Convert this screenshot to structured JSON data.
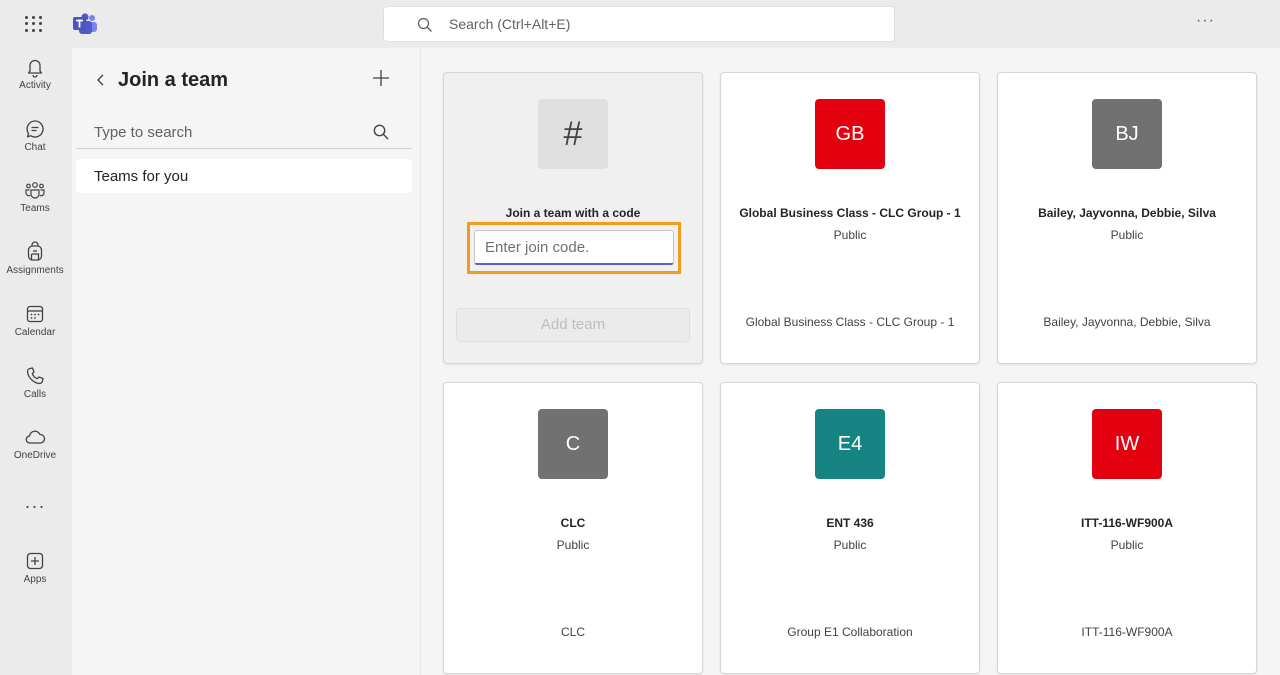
{
  "topbar": {
    "search_placeholder": "Search (Ctrl+Alt+E)",
    "more_label": "···"
  },
  "rail": {
    "items": [
      {
        "label": "Activity",
        "icon": "bell-icon"
      },
      {
        "label": "Chat",
        "icon": "chat-icon"
      },
      {
        "label": "Teams",
        "icon": "teams-icon"
      },
      {
        "label": "Assignments",
        "icon": "backpack-icon"
      },
      {
        "label": "Calendar",
        "icon": "calendar-icon"
      },
      {
        "label": "Calls",
        "icon": "phone-icon"
      },
      {
        "label": "OneDrive",
        "icon": "cloud-icon"
      }
    ],
    "more_label": "···",
    "apps_label": "Apps"
  },
  "panel": {
    "title": "Join a team",
    "search_placeholder": "Type to search",
    "items": [
      {
        "label": "Teams for you"
      }
    ]
  },
  "join_card": {
    "icon_glyph": "#",
    "title": "Join a team with a code",
    "input_placeholder": "Enter join code.",
    "button_label": "Add team"
  },
  "teams": [
    {
      "initials": "GB",
      "color": "#e3000f",
      "name": "Global Business Class - CLC Group - 1",
      "visibility": "Public",
      "description": "Global Business Class - CLC Group - 1"
    },
    {
      "initials": "BJ",
      "color": "#717171",
      "name": "Bailey, Jayvonna, Debbie, Silva",
      "visibility": "Public",
      "description": "Bailey, Jayvonna, Debbie, Silva"
    },
    {
      "initials": "C",
      "color": "#717171",
      "name": "CLC",
      "visibility": "Public",
      "description": "CLC"
    },
    {
      "initials": "E4",
      "color": "#178484",
      "name": "ENT 436",
      "visibility": "Public",
      "description": "Group E1 Collaboration"
    },
    {
      "initials": "IW",
      "color": "#e3000f",
      "name": "ITT-116-WF900A",
      "visibility": "Public",
      "description": "ITT-116-WF900A"
    }
  ],
  "colors": {
    "accent": "#5b5fc7",
    "highlight": "#f29c1f"
  }
}
